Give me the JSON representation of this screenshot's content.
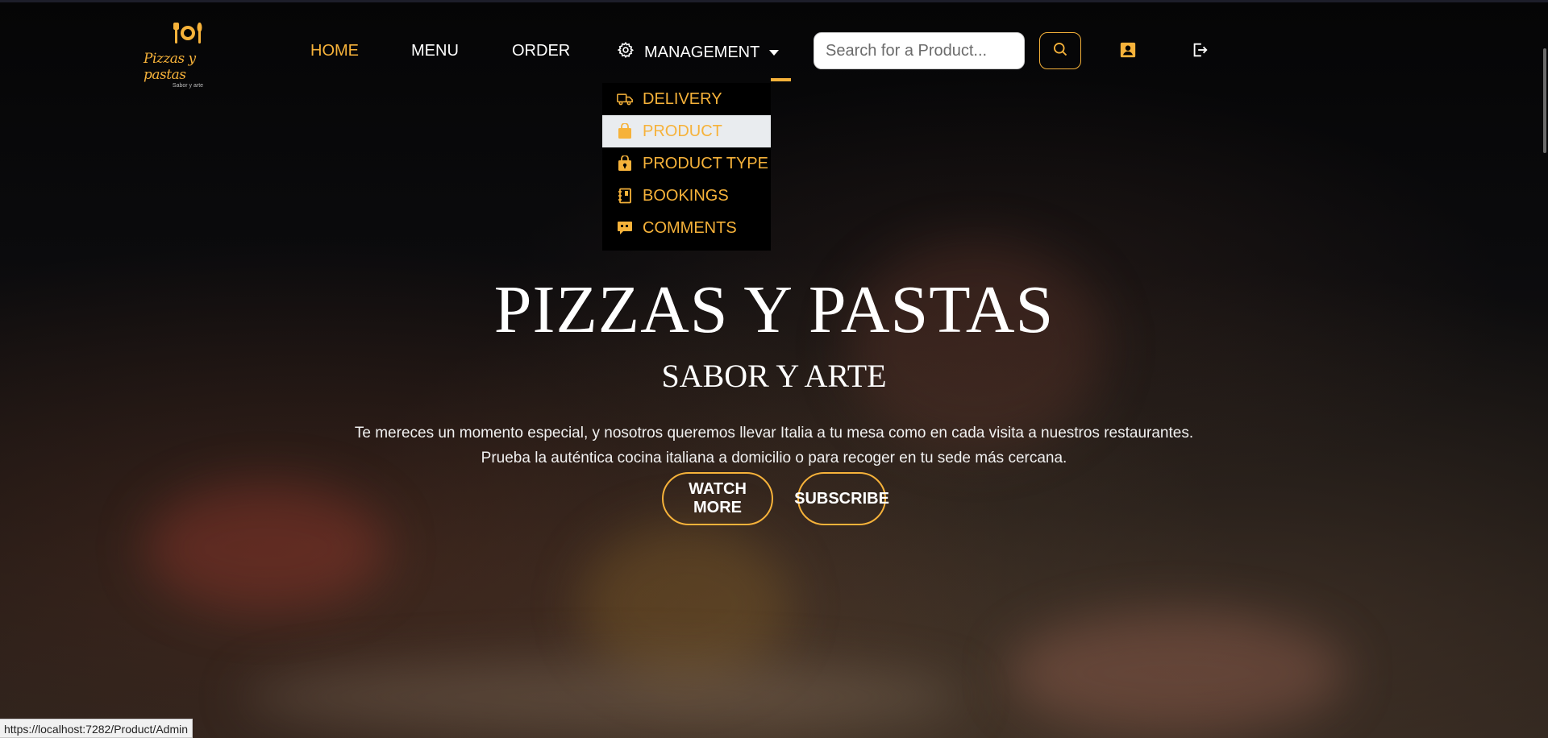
{
  "brand": {
    "logo_text": "Pizzas y pastas",
    "logo_subtext": "Sabor y arte",
    "accent_color": "#f6b23a"
  },
  "nav": {
    "home": "HOME",
    "menu": "MENU",
    "order": "ORDER",
    "management": "MANAGEMENT",
    "active": "HOME"
  },
  "search": {
    "placeholder": "Search for a Product...",
    "value": ""
  },
  "icons": {
    "search": "search-icon",
    "profile": "user-profile-icon",
    "logout": "logout-icon",
    "management": "gear-icon"
  },
  "dropdown": {
    "items": [
      {
        "label": "DELIVERY",
        "icon": "truck-icon"
      },
      {
        "label": "PRODUCT",
        "icon": "shopping-bag-icon",
        "selected": true
      },
      {
        "label": "PRODUCT TYPE",
        "icon": "lock-bag-icon"
      },
      {
        "label": "BOOKINGS",
        "icon": "book-icon"
      },
      {
        "label": "COMMENTS",
        "icon": "quote-comment-icon"
      }
    ]
  },
  "hero": {
    "title": "PIZZAS Y PASTAS",
    "subtitle": "SABOR Y ARTE",
    "description_line1": "Te mereces un momento especial, y nosotros queremos llevar Italia a tu mesa como en cada visita a nuestros restaurantes.",
    "description_line2": "Prueba la auténtica cocina italiana a domicilio o para recoger en tu sede más cercana.",
    "watch_more": "WATCH MORE",
    "subscribe": "SUBSCRIBE"
  },
  "status_bar": {
    "url": "https://localhost:7282/Product/Admin"
  }
}
